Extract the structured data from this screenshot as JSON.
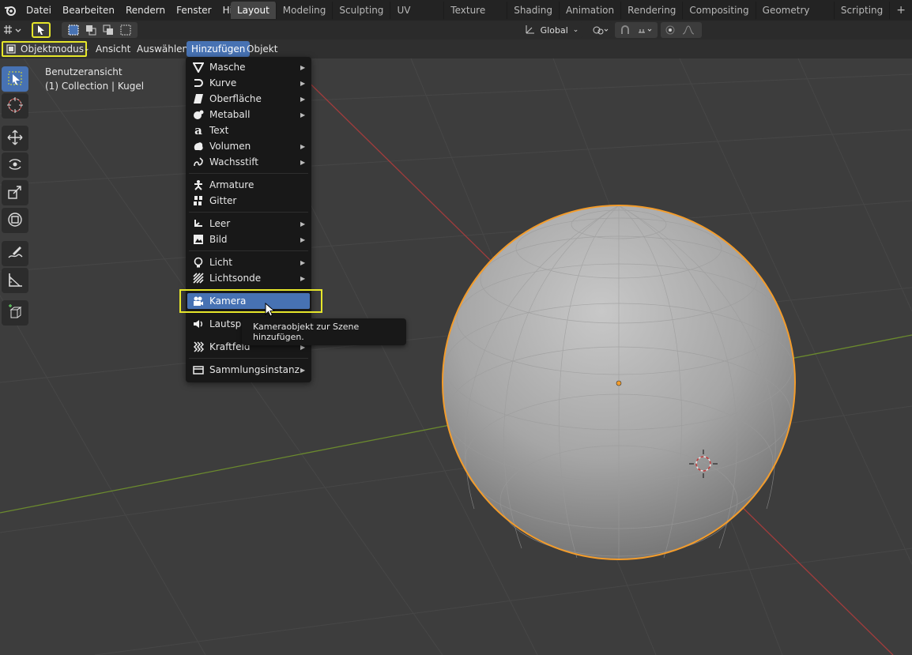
{
  "topmenu": [
    "Datei",
    "Bearbeiten",
    "Rendern",
    "Fenster",
    "Hilfe"
  ],
  "workspace_tabs": [
    "Layout",
    "Modeling",
    "Sculpting",
    "UV Editing",
    "Texture Paint",
    "Shading",
    "Animation",
    "Rendering",
    "Compositing",
    "Geometry Nodes",
    "Scripting"
  ],
  "active_tab": "Layout",
  "add_tab": "+",
  "toolbar": {
    "orientation": "Global"
  },
  "header": {
    "mode": "Objektmodus",
    "menus": [
      "Ansicht",
      "Auswählen",
      "Hinzufügen",
      "Objekt"
    ],
    "active_menu": "Hinzufügen"
  },
  "viewport": {
    "view_name": "Benutzeransicht",
    "collection_info": "(1) Collection | Kugel"
  },
  "add_menu": {
    "items": [
      {
        "label": "Masche",
        "icon": "mesh-icon",
        "submenu": true
      },
      {
        "label": "Kurve",
        "icon": "curve-icon",
        "submenu": true
      },
      {
        "label": "Oberfläche",
        "icon": "surface-icon",
        "submenu": true
      },
      {
        "label": "Metaball",
        "icon": "metaball-icon",
        "submenu": true
      },
      {
        "label": "Text",
        "icon": "text-icon",
        "submenu": false
      },
      {
        "label": "Volumen",
        "icon": "volume-icon",
        "submenu": true
      },
      {
        "label": "Wachsstift",
        "icon": "grease-pencil-icon",
        "submenu": true
      },
      {
        "label": "Armature",
        "icon": "armature-icon",
        "submenu": false
      },
      {
        "label": "Gitter",
        "icon": "lattice-icon",
        "submenu": false
      },
      {
        "label": "Leer",
        "icon": "empty-icon",
        "submenu": true
      },
      {
        "label": "Bild",
        "icon": "image-icon",
        "submenu": true
      },
      {
        "label": "Licht",
        "icon": "light-icon",
        "submenu": true
      },
      {
        "label": "Lichtsonde",
        "icon": "light-probe-icon",
        "submenu": true
      },
      {
        "label": "Kamera",
        "icon": "camera-icon",
        "submenu": false
      },
      {
        "label": "Lautsprecher",
        "icon": "speaker-icon",
        "submenu": false
      },
      {
        "label": "Kraftfeld",
        "icon": "force-field-icon",
        "submenu": true
      },
      {
        "label": "Sammlungsinstanz",
        "icon": "collection-instance-icon",
        "submenu": true
      }
    ],
    "highlighted": "Kamera"
  },
  "tooltip": "Kameraobjekt zur Szene hinzufügen.",
  "colors": {
    "accent": "#4772b3",
    "highlight_box": "#e6e62a",
    "selection_outline": "#f39c2b",
    "x_axis": "#c24a4a",
    "y_axis": "#7aa33a"
  }
}
